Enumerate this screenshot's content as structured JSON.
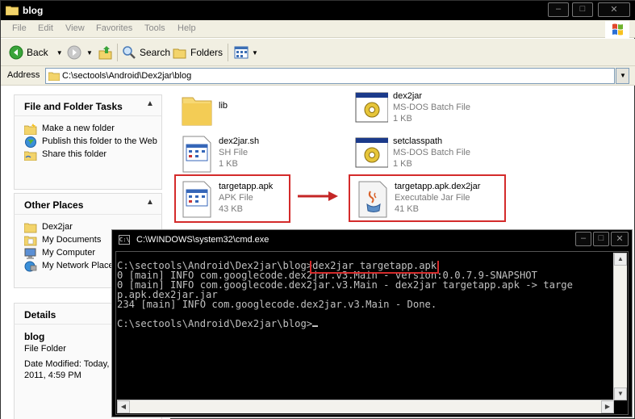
{
  "window": {
    "title": "blog"
  },
  "menu": [
    "File",
    "Edit",
    "View",
    "Favorites",
    "Tools",
    "Help"
  ],
  "toolbar": {
    "back": "Back",
    "search": "Search",
    "folders": "Folders"
  },
  "address": {
    "label": "Address",
    "path": "C:\\sectools\\Android\\Dex2jar\\blog"
  },
  "tasks": {
    "file_folder": {
      "title": "File and Folder Tasks",
      "items": [
        "Make a new folder",
        "Publish this folder to the Web",
        "Share this folder"
      ]
    },
    "other_places": {
      "title": "Other Places",
      "items": [
        "Dex2jar",
        "My Documents",
        "My Computer",
        "My Network Places"
      ]
    },
    "details": {
      "title": "Details",
      "name": "blog",
      "type": "File Folder",
      "modified": "Date Modified: Today, 2011, 4:59 PM"
    }
  },
  "files": [
    {
      "name": "lib",
      "type": "",
      "size": "",
      "icon": "folder-icon"
    },
    {
      "name": "dex2jar.sh",
      "type": "SH File",
      "size": "1 KB",
      "icon": "generic-file-icon"
    },
    {
      "name": "targetapp.apk",
      "type": "APK File",
      "size": "43 KB",
      "icon": "generic-file-icon"
    },
    {
      "name": "dex2jar",
      "type": "MS-DOS Batch File",
      "size": "1 KB",
      "icon": "batch-file-icon"
    },
    {
      "name": "setclasspath",
      "type": "MS-DOS Batch File",
      "size": "1 KB",
      "icon": "batch-file-icon"
    },
    {
      "name": "targetapp.apk.dex2jar",
      "type": "Executable Jar File",
      "size": "41 KB",
      "icon": "java-jar-icon"
    }
  ],
  "cmd": {
    "title": "C:\\WINDOWS\\system32\\cmd.exe",
    "prompt1": "C:\\sectools\\Android\\Dex2jar\\blog>",
    "command": "dex2jar targetapp.apk",
    "lines": [
      "0 [main] INFO com.googlecode.dex2jar.v3.Main - version:0.0.7.9-SNAPSHOT",
      "0 [main] INFO com.googlecode.dex2jar.v3.Main - dex2jar targetapp.apk -> targe",
      "p.apk.dex2jar.jar",
      "234 [main] INFO com.googlecode.dex2jar.v3.Main - Done.",
      ""
    ],
    "prompt2": "C:\\sectools\\Android\\Dex2jar\\blog>"
  },
  "colors": {
    "annotation": "#d42b2b",
    "console_text": "#c0c0c0",
    "console_bg": "#000000"
  }
}
